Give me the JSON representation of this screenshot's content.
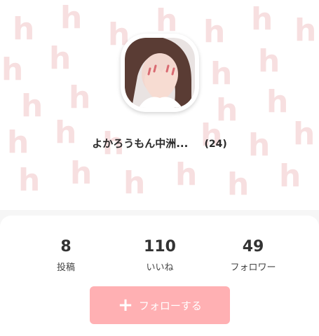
{
  "profile": {
    "name": "よかろうもん中洲...",
    "age": "(24)",
    "avatar": "profile-photo"
  },
  "stats": [
    {
      "value": "8",
      "label": "投稿"
    },
    {
      "value": "110",
      "label": "いいね"
    },
    {
      "value": "49",
      "label": "フォロワー"
    }
  ],
  "follow": {
    "label": "フォローする",
    "icon": "plus-icon"
  },
  "colors": {
    "pattern": "#f7dfe0",
    "follow_button": "#ffb0b3"
  }
}
